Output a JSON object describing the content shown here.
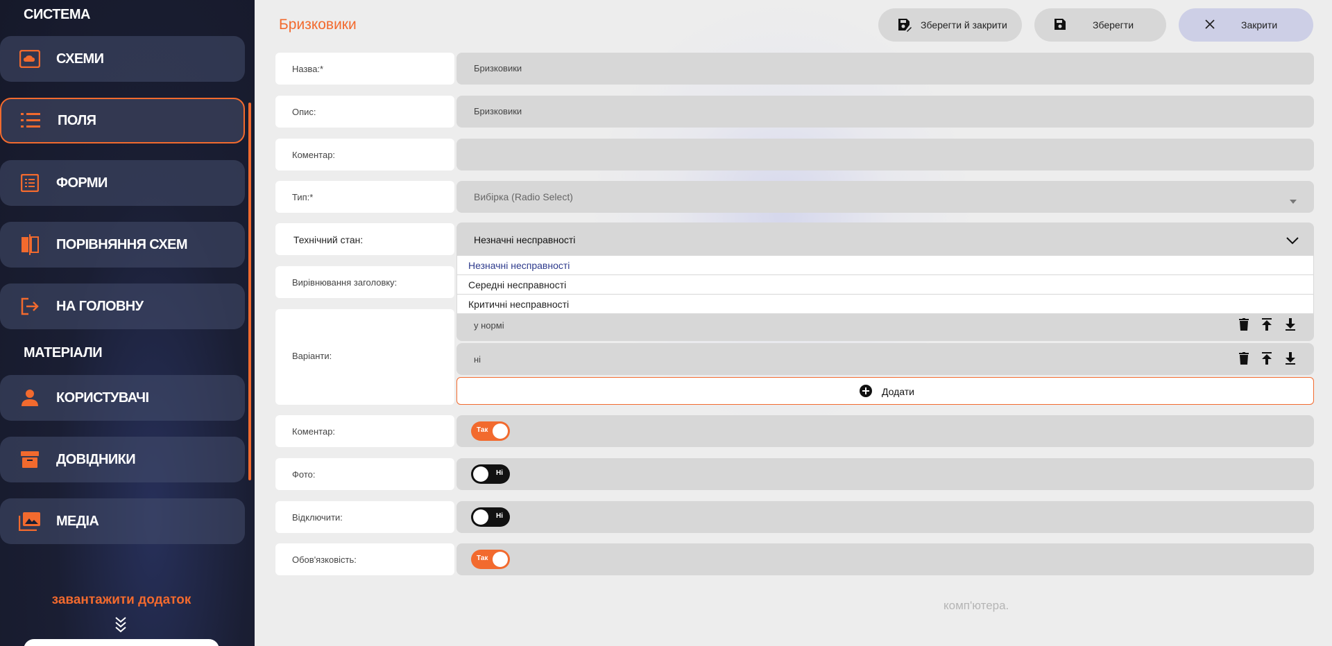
{
  "sidebar": {
    "section_system": "СИСТЕМА",
    "section_materials": "МАТЕРІАЛИ",
    "items": [
      {
        "label": "СХЕМИ",
        "icon": "cloud-icon"
      },
      {
        "label": "ПОЛЯ",
        "icon": "list-icon",
        "active": true
      },
      {
        "label": "ФОРМИ",
        "icon": "form-icon"
      },
      {
        "label": "ПОРІВНЯННЯ СХЕМ",
        "icon": "compare-icon"
      },
      {
        "label": "НА ГОЛОВНУ",
        "icon": "exit-icon"
      },
      {
        "label": "КОРИСТУВАЧІ",
        "icon": "user-icon"
      },
      {
        "label": "ДОВІДНИКИ",
        "icon": "archive-icon"
      },
      {
        "label": "МЕДІА",
        "icon": "photo-icon"
      }
    ],
    "download_app": "завантажити додаток"
  },
  "header": {
    "title": "Бризковики",
    "save_close_label": "Зберегти й закрити",
    "save_label": "Зберегти",
    "close_label": "Закрити"
  },
  "form": {
    "name_label": "Назва:*",
    "name_value": "Бризковики",
    "description_label": "Опис:",
    "description_value": "Бризковики",
    "comment_label": "Коментар:",
    "comment_value": "",
    "type_label": "Тип:*",
    "type_value": "Вибірка (Radio Select)",
    "tech_state_label": "Технічний стан:",
    "tech_state_value": "Незначні несправності",
    "tech_state_options": [
      "Незначні несправності",
      "Середні несправності",
      "Критичні несправності"
    ],
    "title_align_label": "Вирівнювання заголовку:",
    "variants_label": "Варіанти:",
    "variants": [
      "у нормі",
      "ні"
    ],
    "add_label": "Додати",
    "comment_toggle_label": "Коментар:",
    "comment_toggle_value": "Так",
    "photo_label": "Фото:",
    "photo_value": "Ні",
    "disable_label": "Відключити:",
    "disable_value": "Ні",
    "required_label": "Обов'язковість:",
    "required_value": "Так"
  },
  "footer_text": "комп'ютера.",
  "colors": {
    "accent": "#f26a2e",
    "sidebar_bg": "#1a1e33",
    "field_bg": "#d7d7d7"
  }
}
